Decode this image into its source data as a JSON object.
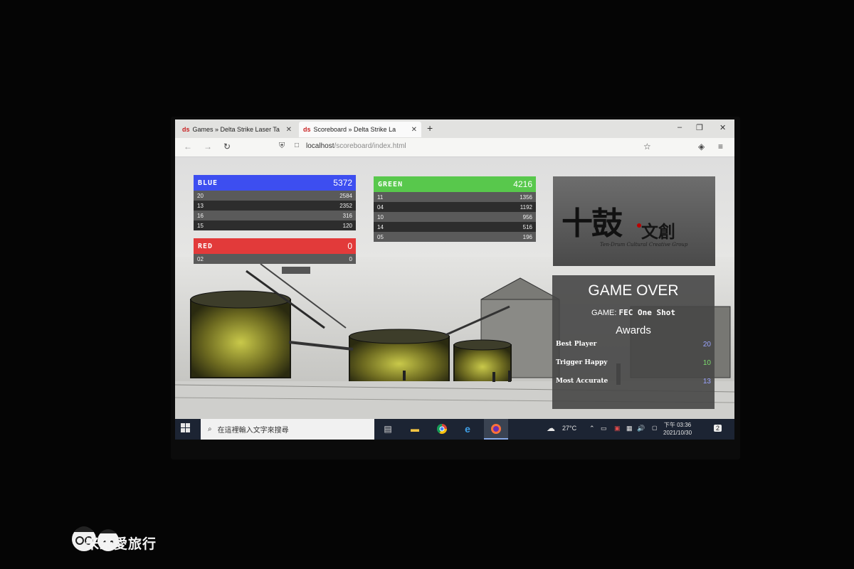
{
  "browser": {
    "tabs": [
      {
        "favicon": "ds",
        "title": "Games » Delta Strike Laser Ta",
        "close": "✕"
      },
      {
        "favicon": "ds",
        "title": "Scoreboard » Delta Strike La",
        "close": "✕"
      }
    ],
    "new_tab": "+",
    "url_host": "localhost",
    "url_path": "/scoreboard/index.html"
  },
  "scoreboard": {
    "teams": [
      {
        "name": "BLUE",
        "score": "5372",
        "color": "#3d4ef0",
        "players": [
          [
            "20",
            "2584"
          ],
          [
            "13",
            "2352"
          ],
          [
            "16",
            "316"
          ],
          [
            "15",
            "120"
          ]
        ]
      },
      {
        "name": "GREEN",
        "score": "4216",
        "color": "#58c84c",
        "players": [
          [
            "11",
            "1356"
          ],
          [
            "04",
            "1192"
          ],
          [
            "10",
            "956"
          ],
          [
            "14",
            "516"
          ],
          [
            "05",
            "196"
          ]
        ]
      },
      {
        "name": "RED",
        "score": "0",
        "color": "#e23a3a",
        "players": [
          [
            "02",
            "0"
          ]
        ]
      }
    ]
  },
  "logo": {
    "main": "十鼓",
    "sub": "文創",
    "english": "Ten-Drum Cultural Creative Group"
  },
  "game_over": {
    "title": "GAME OVER",
    "game_label": "GAME:",
    "game_name": "FEC One Shot",
    "awards_title": "Awards",
    "awards": [
      {
        "label": "Best Player",
        "value": "20",
        "color": "#9aa4ff"
      },
      {
        "label": "Trigger Happy",
        "value": "10",
        "color": "#7ddc6e"
      },
      {
        "label": "Most Accurate",
        "value": "13",
        "color": "#9aa4ff"
      }
    ]
  },
  "taskbar": {
    "search_placeholder": "在這裡輸入文字來搜尋",
    "weather": "27°C",
    "ime": "英",
    "time": "下午 03:36",
    "date": "2021/10/30",
    "notifications": "2"
  },
  "watermark": {
    "text": "米米愛旅行"
  }
}
